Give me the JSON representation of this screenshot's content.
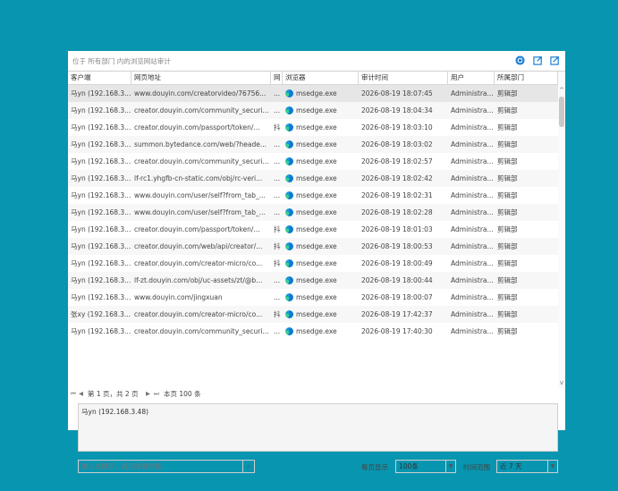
{
  "window": {
    "title": "位于 所有部门 内的浏览网站审计"
  },
  "toolbar": {
    "refresh_icon": "refresh-icon",
    "export_icon": "export-icon",
    "export_all_icon": "export-all-icon"
  },
  "columns": [
    "客户端",
    "网页地址",
    "网",
    "浏览器",
    "审计时间",
    "用户",
    "所属部门"
  ],
  "rows": [
    {
      "client": "马yn (192.168.3...",
      "url": "www.douyin.com/creatorvideo/76756...",
      "mark": "...",
      "browser": "msedge.exe",
      "time": "2026-08-19 18:07:45",
      "user": "Administra...",
      "dept": "剪辑部"
    },
    {
      "client": "马yn (192.168.3...",
      "url": "creator.douyin.com/community_securi...",
      "mark": "...",
      "browser": "msedge.exe",
      "time": "2026-08-19 18:04:34",
      "user": "Administra...",
      "dept": "剪辑部"
    },
    {
      "client": "马yn (192.168.3...",
      "url": "creator.douyin.com/passport/token/...",
      "mark": "抖",
      "browser": "msedge.exe",
      "time": "2026-08-19 18:03:10",
      "user": "Administra...",
      "dept": "剪辑部"
    },
    {
      "client": "马yn (192.168.3...",
      "url": "summon.bytedance.com/web/?heade...",
      "mark": "...",
      "browser": "msedge.exe",
      "time": "2026-08-19 18:03:02",
      "user": "Administra...",
      "dept": "剪辑部"
    },
    {
      "client": "马yn (192.168.3...",
      "url": "creator.douyin.com/community_securi...",
      "mark": "...",
      "browser": "msedge.exe",
      "time": "2026-08-19 18:02:57",
      "user": "Administra...",
      "dept": "剪辑部"
    },
    {
      "client": "马yn (192.168.3...",
      "url": "lf-rc1.yhgfb-cn-static.com/obj/rc-veri...",
      "mark": "...",
      "browser": "msedge.exe",
      "time": "2026-08-19 18:02:42",
      "user": "Administra...",
      "dept": "剪辑部"
    },
    {
      "client": "马yn (192.168.3...",
      "url": "www.douyin.com/user/self?from_tab_...",
      "mark": "...",
      "browser": "msedge.exe",
      "time": "2026-08-19 18:02:31",
      "user": "Administra...",
      "dept": "剪辑部"
    },
    {
      "client": "马yn (192.168.3...",
      "url": "www.douyin.com/user/self?from_tab_...",
      "mark": "...",
      "browser": "msedge.exe",
      "time": "2026-08-19 18:02:28",
      "user": "Administra...",
      "dept": "剪辑部"
    },
    {
      "client": "马yn (192.168.3...",
      "url": "creator.douyin.com/passport/token/...",
      "mark": "抖",
      "browser": "msedge.exe",
      "time": "2026-08-19 18:01:03",
      "user": "Administra...",
      "dept": "剪辑部"
    },
    {
      "client": "马yn (192.168.3...",
      "url": "creator.douyin.com/web/api/creator/...",
      "mark": "抖",
      "browser": "msedge.exe",
      "time": "2026-08-19 18:00:53",
      "user": "Administra...",
      "dept": "剪辑部"
    },
    {
      "client": "马yn (192.168.3...",
      "url": "creator.douyin.com/creator-micro/co...",
      "mark": "抖",
      "browser": "msedge.exe",
      "time": "2026-08-19 18:00:49",
      "user": "Administra...",
      "dept": "剪辑部"
    },
    {
      "client": "马yn (192.168.3...",
      "url": "lf-zt.douyin.com/obj/uc-assets/zt/@b...",
      "mark": "...",
      "browser": "msedge.exe",
      "time": "2026-08-19 18:00:44",
      "user": "Administra...",
      "dept": "剪辑部"
    },
    {
      "client": "马yn (192.168.3...",
      "url": "www.douyin.com/jingxuan",
      "mark": "...",
      "browser": "msedge.exe",
      "time": "2026-08-19 18:00:07",
      "user": "Administra...",
      "dept": "剪辑部"
    },
    {
      "client": "张xy (192.168.3...",
      "url": "creator.douyin.com/creator-micro/co...",
      "mark": "抖",
      "browser": "msedge.exe",
      "time": "2026-08-19 17:42:37",
      "user": "Administra...",
      "dept": "剪辑部"
    },
    {
      "client": "马yn (192.168.3...",
      "url": "creator.douyin.com/community_securi...",
      "mark": "...",
      "browser": "msedge.exe",
      "time": "2026-08-19 17:40:30",
      "user": "Administra...",
      "dept": "剪辑部"
    }
  ],
  "pager": {
    "page_text": "第 1 页，共 2 页",
    "count_text": "本页 100 条"
  },
  "detail": {
    "text": "马yn (192.168.3.48)"
  },
  "search": {
    "placeholder": "输入关键字，按回车键检索"
  },
  "page_size": {
    "label": "每页显示",
    "value": "100条"
  },
  "time_range": {
    "label": "时间范围",
    "value": "近 7 天"
  },
  "colors": {
    "background": "#0795b0",
    "accent": "#1a7fd6"
  }
}
